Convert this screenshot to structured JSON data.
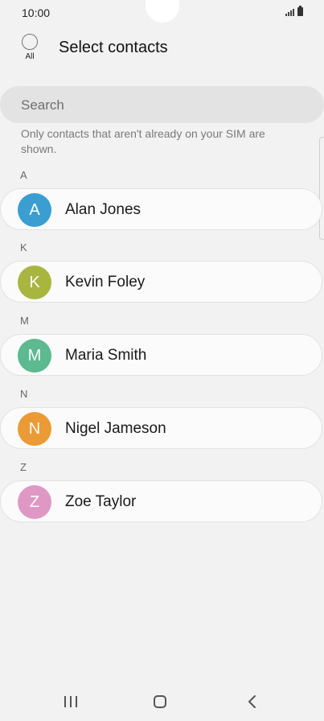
{
  "status_bar": {
    "time": "10:00"
  },
  "header": {
    "all_label": "All",
    "title": "Select contacts"
  },
  "search": {
    "placeholder": "Search"
  },
  "note": "Only contacts that aren't already on your SIM are shown.",
  "sections": [
    {
      "letter": "A",
      "contact": {
        "initial": "A",
        "name": "Alan Jones",
        "color": "#3a9fd0"
      }
    },
    {
      "letter": "K",
      "contact": {
        "initial": "K",
        "name": "Kevin Foley",
        "color": "#a8b640"
      }
    },
    {
      "letter": "M",
      "contact": {
        "initial": "M",
        "name": "Maria Smith",
        "color": "#5cb990"
      }
    },
    {
      "letter": "N",
      "contact": {
        "initial": "N",
        "name": "Nigel Jameson",
        "color": "#eb9a35"
      }
    },
    {
      "letter": "Z",
      "contact": {
        "initial": "Z",
        "name": "Zoe Taylor",
        "color": "#df98c4"
      }
    }
  ],
  "nav_bar": {
    "icons": [
      "recents-icon",
      "home-icon",
      "back-icon"
    ]
  }
}
